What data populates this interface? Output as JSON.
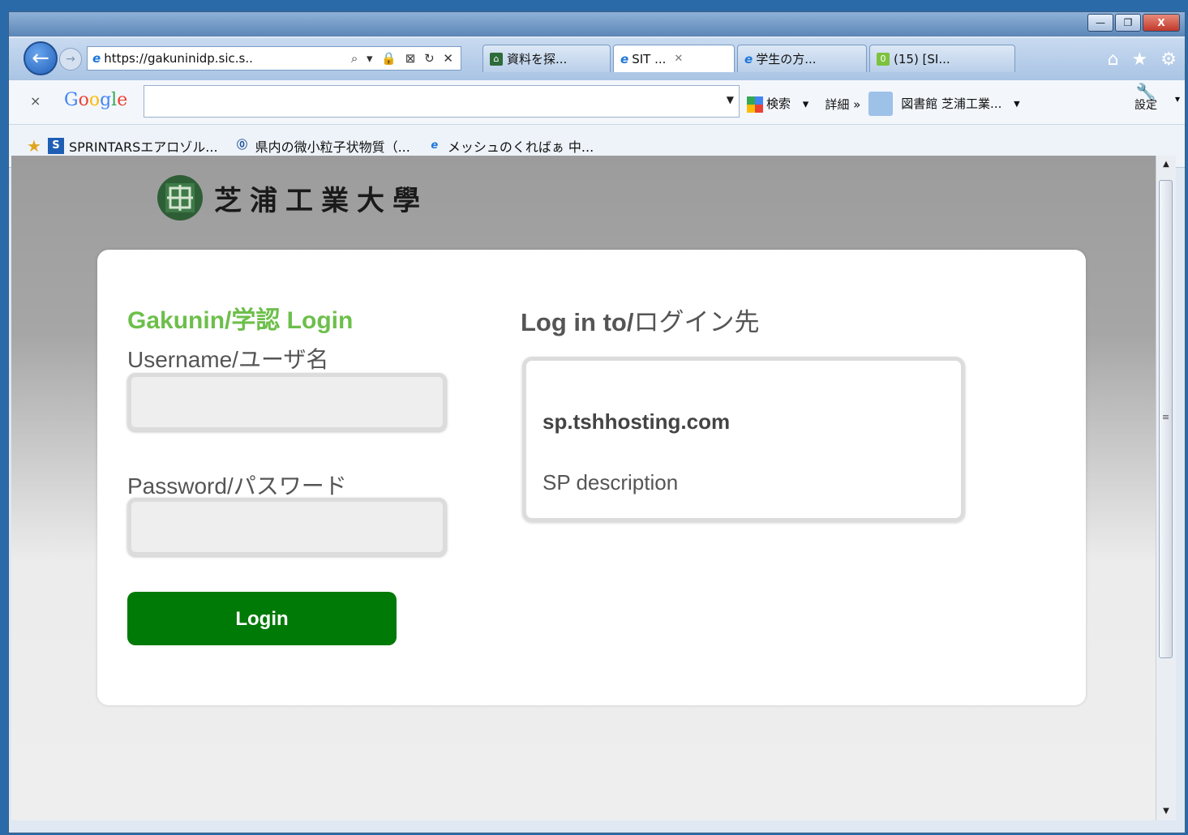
{
  "browser": {
    "address": "https://gakuninidp.sic.s..",
    "address_tools": "⌕ ▾ 🔒 ⊠ ↻ ✕",
    "tabs": [
      {
        "label": "資料を探..."
      },
      {
        "label": "SIT ..."
      },
      {
        "label": "学生の方..."
      },
      {
        "label": "(15) [SI..."
      }
    ],
    "window_controls": [
      "—",
      "❐",
      "X"
    ]
  },
  "google_bar": {
    "close": "×",
    "logo": "Google",
    "search_value": "",
    "search_label": "検索",
    "details_label": "詳細 »",
    "profile_label": "図書館 芝浦工業...",
    "settings_label": "設定"
  },
  "favorites": [
    {
      "label": "SPRINTARSエアロゾル...",
      "icon": "S"
    },
    {
      "label": "県内の微小粒子状物質（...",
      "icon": "⓪"
    },
    {
      "label": "メッシュのくればぁ 中...",
      "icon": "e"
    }
  ],
  "page": {
    "university_name": "芝浦工業大學",
    "login_title": "Gakunin/学認 Login",
    "username_label": "Username/ユーザ名",
    "username_value": "",
    "password_label": "Password/パスワード",
    "password_value": "",
    "login_button": "Login",
    "dest_title_bold": "Log in to/",
    "dest_title_rest": "ログイン先",
    "sp_name": "sp.tshhosting.com",
    "sp_description": "SP description"
  },
  "colors": {
    "login_title": "#6dbf4b",
    "login_button": "#007a06"
  }
}
